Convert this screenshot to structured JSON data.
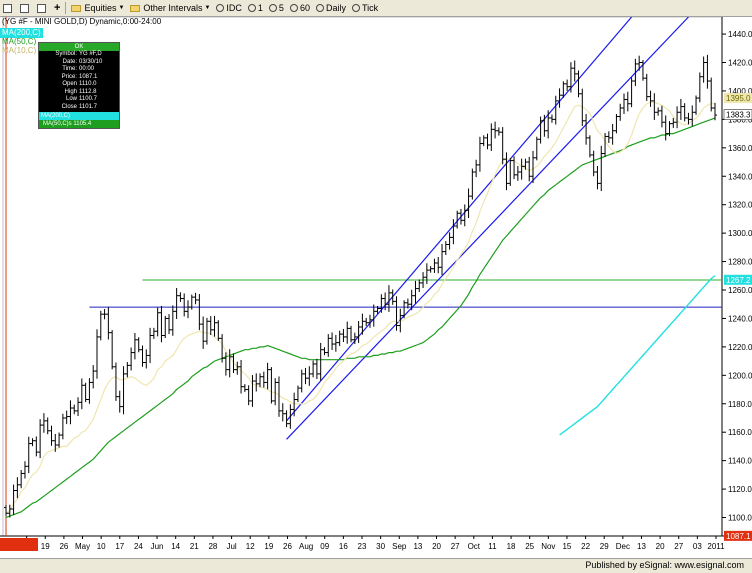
{
  "toolbar": {
    "items": [
      "Equities",
      "Other Intervals",
      "IDC",
      "1",
      "5",
      "60",
      "Daily",
      "Tick"
    ]
  },
  "chart_header": "(YG #F - MINI GOLD,D) Dynamic,0:00-24:00",
  "legend": {
    "ma200_label": "MA(200,C)",
    "ma50_label": "MA(50,C)",
    "ma10_label": "MA(10,C)"
  },
  "cursor_box": {
    "header": "OK",
    "rows": [
      {
        "k": "Symbol:",
        "v": "YG #F,D"
      },
      {
        "k": "Date:",
        "v": "03/30/10"
      },
      {
        "k": "Time:",
        "v": "00:00"
      },
      {
        "k": "Price:",
        "v": "1087.1"
      },
      {
        "k": "Open",
        "v": "1110.0"
      },
      {
        "k": "High",
        "v": "1112.8"
      },
      {
        "k": "Low",
        "v": "1100.7"
      },
      {
        "k": "Close",
        "v": "1101.7"
      }
    ],
    "ma200_row": "MA(200,C)",
    "ma50_row": "MA(50,C)s  1105.4"
  },
  "colors": {
    "background": "#ffffff",
    "price_bar": "#000000",
    "ma10": "#efe6b0",
    "ma50": "#1e9e1e",
    "ma200": "#22e0e0",
    "channel": "#1a1af0",
    "hline_green": "#28b028",
    "hline_blue": "#2020c0",
    "last_price_tag": "#2a8acb",
    "cursor_tag": "#e03010"
  },
  "status_text": "Published by eSignal: www.esignal.com",
  "chart_data": {
    "type": "ohlc",
    "symbol": "YG #F - MINI GOLD",
    "interval": "Daily",
    "x_labels": [
      "03/30/10",
      "Apr",
      "19",
      "26",
      "May",
      "10",
      "17",
      "24",
      "Jun",
      "14",
      "21",
      "28",
      "Jul",
      "12",
      "19",
      "26",
      "Aug",
      "09",
      "16",
      "23",
      "30",
      "Sep",
      "13",
      "20",
      "27",
      "Oct",
      "11",
      "18",
      "25",
      "Nov",
      "15",
      "22",
      "29",
      "Dec",
      "13",
      "20",
      "27",
      "03",
      "2011"
    ],
    "ylim": [
      1087,
      1452
    ],
    "y_ticks": [
      1100,
      1120,
      1140,
      1160,
      1180,
      1200,
      1220,
      1240,
      1260,
      1280,
      1300,
      1320,
      1340,
      1360,
      1380,
      1400,
      1420,
      1440
    ],
    "price_tags": [
      {
        "label": "1395.0",
        "value": 1395.0
      },
      {
        "label": "1383.3",
        "value": 1383.3
      },
      {
        "label": "1267.2",
        "value": 1267.2
      },
      {
        "label": "1087.1",
        "value": 1087.1
      }
    ],
    "horizontal_lines": [
      {
        "name": "resistance-green",
        "value": 1267
      },
      {
        "name": "resistance-blue",
        "value": 1248
      }
    ],
    "closes": [
      1103,
      1106,
      1119,
      1123,
      1131,
      1136,
      1152,
      1154,
      1146,
      1165,
      1168,
      1161,
      1154,
      1151,
      1158,
      1170,
      1171,
      1177,
      1175,
      1181,
      1193,
      1183,
      1195,
      1203,
      1227,
      1243,
      1243,
      1230,
      1206,
      1185,
      1178,
      1201,
      1207,
      1216,
      1225,
      1218,
      1209,
      1214,
      1228,
      1231,
      1244,
      1228,
      1240,
      1232,
      1245,
      1256,
      1254,
      1245,
      1248,
      1255,
      1253,
      1236,
      1224,
      1238,
      1232,
      1237,
      1226,
      1212,
      1204,
      1213,
      1204,
      1206,
      1192,
      1190,
      1182,
      1196,
      1194,
      1199,
      1195,
      1204,
      1182,
      1195,
      1175,
      1173,
      1166,
      1176,
      1183,
      1191,
      1201,
      1198,
      1201,
      1208,
      1201,
      1218,
      1216,
      1226,
      1222,
      1223,
      1229,
      1227,
      1233,
      1225,
      1227,
      1234,
      1238,
      1237,
      1239,
      1245,
      1247,
      1254,
      1250,
      1258,
      1252,
      1235,
      1242,
      1251,
      1250,
      1256,
      1261,
      1265,
      1269,
      1274,
      1275,
      1279,
      1276,
      1287,
      1292,
      1297,
      1305,
      1314,
      1309,
      1316,
      1326,
      1343,
      1348,
      1363,
      1367,
      1362,
      1373,
      1372,
      1371,
      1352,
      1335,
      1351,
      1341,
      1343,
      1347,
      1350,
      1340,
      1353,
      1366,
      1379,
      1372,
      1381,
      1380,
      1393,
      1397,
      1405,
      1403,
      1416,
      1412,
      1398,
      1379,
      1367,
      1355,
      1343,
      1335,
      1356,
      1368,
      1367,
      1372,
      1382,
      1388,
      1394,
      1391,
      1407,
      1419,
      1420,
      1409,
      1396,
      1393,
      1385,
      1386,
      1378,
      1370,
      1377,
      1378,
      1385,
      1389,
      1381,
      1380,
      1385,
      1395,
      1410,
      1420,
      1407,
      1388,
      1383
    ],
    "ma10": [
      1103,
      1105,
      1110,
      1113,
      1118,
      1121,
      1126,
      1130,
      1132,
      1136,
      1143,
      1146,
      1147,
      1148,
      1149,
      1150,
      1150,
      1153,
      1156,
      1157,
      1160,
      1161,
      1165,
      1169,
      1176,
      1183,
      1190,
      1195,
      1198,
      1199,
      1197,
      1197,
      1198,
      1199,
      1198,
      1196,
      1194,
      1193,
      1195,
      1198,
      1204,
      1206,
      1210,
      1212,
      1214,
      1218,
      1223,
      1226,
      1228,
      1229,
      1230,
      1231,
      1230,
      1230,
      1229,
      1227,
      1225,
      1222,
      1217,
      1213,
      1209,
      1206,
      1203,
      1201,
      1198,
      1194,
      1193,
      1192,
      1191,
      1190,
      1188,
      1188,
      1186,
      1184,
      1183,
      1181,
      1180,
      1180,
      1180,
      1180,
      1182,
      1183,
      1186,
      1190,
      1195,
      1198,
      1201,
      1205,
      1208,
      1210,
      1213,
      1215,
      1216,
      1218,
      1221,
      1222,
      1224,
      1227,
      1229,
      1231,
      1233,
      1236,
      1238,
      1238,
      1238,
      1239,
      1241,
      1242,
      1243,
      1245,
      1248,
      1251,
      1253,
      1257,
      1259,
      1264,
      1268,
      1272,
      1276,
      1281,
      1285,
      1289,
      1294,
      1301,
      1307,
      1315,
      1322,
      1328,
      1335,
      1341,
      1347,
      1351,
      1352,
      1352,
      1351,
      1349,
      1347,
      1346,
      1344,
      1345,
      1347,
      1350,
      1354,
      1357,
      1360,
      1364,
      1369,
      1374,
      1379,
      1384,
      1389,
      1390,
      1389,
      1387,
      1384,
      1378,
      1372,
      1369,
      1365,
      1361,
      1358,
      1356,
      1357,
      1359,
      1363,
      1369,
      1377,
      1384,
      1388,
      1391,
      1392,
      1392,
      1391,
      1390,
      1388,
      1386,
      1382,
      1379,
      1377,
      1376,
      1377,
      1379,
      1381,
      1384,
      1388,
      1390,
      1391,
      1391
    ],
    "ma50": [
      1100,
      1101,
      1102,
      1103,
      1104,
      1106,
      1108,
      1110,
      1111,
      1113,
      1115,
      1117,
      1119,
      1121,
      1123,
      1125,
      1127,
      1129,
      1131,
      1133,
      1135,
      1137,
      1139,
      1141,
      1144,
      1147,
      1150,
      1153,
      1155,
      1157,
      1159,
      1161,
      1163,
      1165,
      1167,
      1169,
      1171,
      1173,
      1175,
      1177,
      1179,
      1181,
      1183,
      1185,
      1187,
      1190,
      1192,
      1194,
      1196,
      1199,
      1201,
      1203,
      1205,
      1206,
      1208,
      1210,
      1211,
      1212,
      1213,
      1214,
      1215,
      1216,
      1217,
      1218,
      1218,
      1219,
      1219,
      1220,
      1220,
      1221,
      1220,
      1219,
      1218,
      1217,
      1216,
      1215,
      1214,
      1213,
      1212,
      1212,
      1211,
      1211,
      1211,
      1211,
      1211,
      1211,
      1211,
      1211,
      1211,
      1211,
      1212,
      1212,
      1212,
      1213,
      1213,
      1213,
      1213,
      1214,
      1214,
      1215,
      1215,
      1216,
      1216,
      1217,
      1217,
      1218,
      1219,
      1220,
      1221,
      1222,
      1223,
      1225,
      1227,
      1229,
      1232,
      1234,
      1237,
      1240,
      1243,
      1246,
      1249,
      1253,
      1257,
      1262,
      1266,
      1271,
      1275,
      1279,
      1283,
      1287,
      1291,
      1295,
      1298,
      1301,
      1304,
      1307,
      1310,
      1313,
      1316,
      1319,
      1322,
      1325,
      1327,
      1330,
      1332,
      1334,
      1336,
      1338,
      1340,
      1342,
      1344,
      1346,
      1348,
      1349,
      1350,
      1351,
      1352,
      1353,
      1354,
      1355,
      1356,
      1357,
      1358,
      1359,
      1361,
      1362,
      1363,
      1364,
      1365,
      1366,
      1367,
      1367,
      1368,
      1369,
      1369,
      1370,
      1370,
      1371,
      1372,
      1373,
      1374,
      1375,
      1376,
      1377,
      1378,
      1379,
      1380,
      1381
    ],
    "ma200": [
      1158,
      1160,
      1162,
      1164,
      1166,
      1168,
      1170,
      1172,
      1174,
      1176,
      1178,
      1181,
      1184,
      1187,
      1190,
      1193,
      1196,
      1199,
      1202,
      1205,
      1208,
      1211,
      1214,
      1217,
      1220,
      1223,
      1226,
      1229,
      1232,
      1235,
      1238,
      1241,
      1244,
      1247,
      1250,
      1253,
      1256,
      1259,
      1262,
      1265,
      1268,
      1270
    ]
  }
}
